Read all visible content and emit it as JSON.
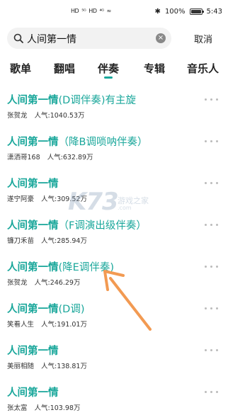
{
  "status_bar": {
    "left": [
      "HD",
      "⁵ᴳ",
      "HD",
      "⁴ᴳ",
      "≈"
    ],
    "bluetooth": "✱",
    "battery_pct": "100%",
    "battery_level": 1.0,
    "time": "5:43"
  },
  "search": {
    "query": "人间第一情",
    "clear": "×",
    "cancel": "取消"
  },
  "tabs": [
    {
      "label": "歌单"
    },
    {
      "label": "翻唱"
    },
    {
      "label": "伴奏"
    },
    {
      "label": "专辑"
    },
    {
      "label": "音乐人"
    }
  ],
  "active_tab": "伴奏",
  "accent_color": "#1aa79b",
  "results": [
    {
      "highlight": "人间第一情",
      "rest": "(D调伴奏)有主旋",
      "author": "张贺龙",
      "popularity": "人气:1040.53万"
    },
    {
      "highlight": "人间第一情",
      "rest": "（降B调唢呐伴奏）",
      "author": "潇洒哥168",
      "popularity": "人气:632.89万"
    },
    {
      "highlight": "人间第一情",
      "rest": "",
      "author": "遂宁阿豪",
      "popularity": "人气:309.52万"
    },
    {
      "highlight": "人间第一情",
      "rest": "（F调演出级伴奏）",
      "author": "镰刀禾苗",
      "popularity": "人气:285.94万"
    },
    {
      "highlight": "人间第一情",
      "rest": "(降E调伴奏)",
      "author": "张贺龙",
      "popularity": "人气:246.29万"
    },
    {
      "highlight": "人间第一情",
      "rest": "(D调)",
      "author": "笑看人生",
      "popularity": "人气:191.01万"
    },
    {
      "highlight": "人间第一情",
      "rest": "",
      "author": "美丽相随",
      "popularity": "人气:138.81万"
    },
    {
      "highlight": "人间第一情",
      "rest": "",
      "author": "张太富",
      "popularity": "人气:103.98万"
    }
  ],
  "watermark": {
    "logo": "K73",
    "sub": "游戏之家",
    "url": ".com"
  }
}
